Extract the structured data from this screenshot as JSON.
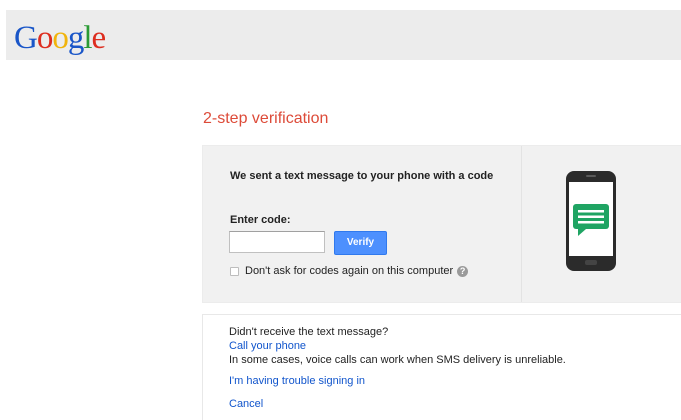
{
  "header": {
    "logo_text": "Google",
    "logo_letters": [
      {
        "char": "G",
        "color": "#1a56c8"
      },
      {
        "char": "o",
        "color": "#dd2d1f"
      },
      {
        "char": "o",
        "color": "#f1b40c"
      },
      {
        "char": "g",
        "color": "#1a56c8"
      },
      {
        "char": "l",
        "color": "#2a9a34"
      },
      {
        "char": "e",
        "color": "#dd2d1f"
      }
    ],
    "background_color": "#ececec"
  },
  "page_title": "2-step verification",
  "page_title_color": "#dd4b39",
  "verify": {
    "message": "We sent a text message to your phone with a code",
    "code_label": "Enter code:",
    "code_value": "",
    "verify_button_label": "Verify",
    "verify_button_color": "#4d90fe",
    "remember_label": "Don't ask for codes again on this computer",
    "remember_checked": false,
    "help_icon": "question-circle-icon",
    "illustration_icon": "smartphone-sms-icon",
    "sms_bubble_color": "#1fa463"
  },
  "help": {
    "question": "Didn't receive the text message?",
    "call_link": "Call your phone",
    "call_note": "In some cases, voice calls can work when SMS delivery is unreliable.",
    "trouble_link": "I'm having trouble signing in",
    "cancel_link": "Cancel",
    "link_color": "#1155cc"
  }
}
